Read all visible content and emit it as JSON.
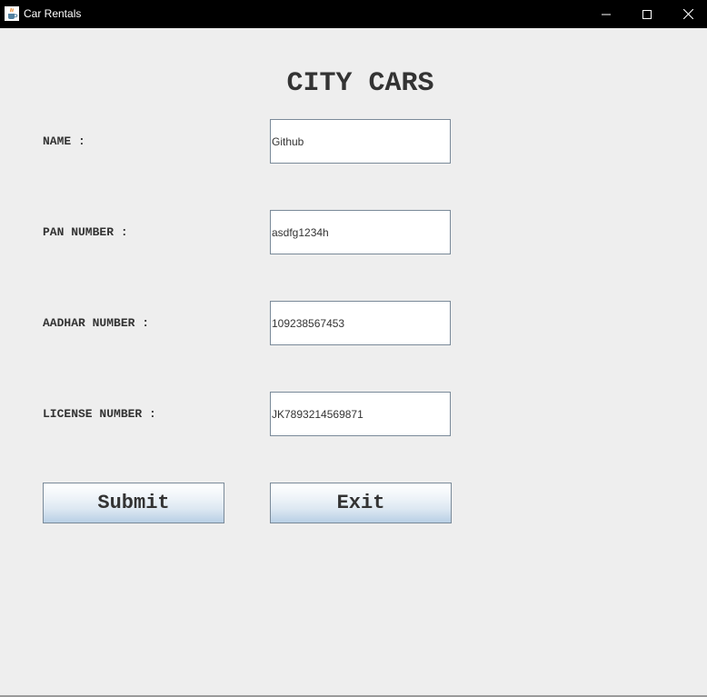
{
  "window": {
    "title": "Car Rentals",
    "app_icon": "java-cup-icon",
    "controls": {
      "minimize_icon": "minimize-icon",
      "maximize_icon": "maximize-icon",
      "close_icon": "close-icon"
    }
  },
  "form": {
    "heading": "CITY CARS",
    "fields": [
      {
        "label": "NAME :",
        "value": "Github"
      },
      {
        "label": "PAN NUMBER :",
        "value": "asdfg1234h"
      },
      {
        "label": "AADHAR NUMBER :",
        "value": "109238567453"
      },
      {
        "label": "LICENSE NUMBER :",
        "value": "JK7893214569871"
      }
    ],
    "submit_label": "Submit",
    "exit_label": "Exit"
  },
  "colors": {
    "titlebar": "#000000",
    "background": "#eeeeee",
    "text": "#333333",
    "button_gradient_bottom": "#b8cfe5"
  }
}
